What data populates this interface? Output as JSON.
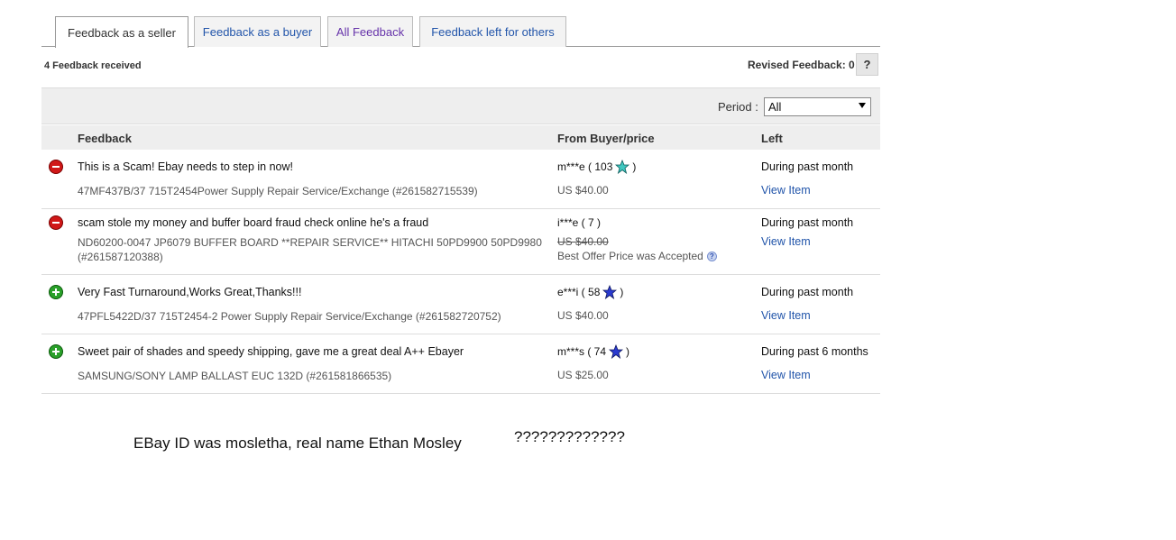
{
  "tabs": [
    {
      "label": "Feedback as a seller",
      "active": true
    },
    {
      "label": "Feedback as a buyer",
      "active": false
    },
    {
      "label": "All Feedback",
      "active": false
    },
    {
      "label": "Feedback left for others",
      "active": false
    }
  ],
  "summary": {
    "received": "4 Feedback received",
    "revised": "Revised Feedback: 0",
    "help": "?"
  },
  "period": {
    "label": "Period :",
    "selected": "All"
  },
  "columns": {
    "feedback": "Feedback",
    "from": "From Buyer/price",
    "left": "Left"
  },
  "rows": [
    {
      "rating": "negative",
      "comment": "This is a Scam! Ebay needs to step in now!",
      "item": "47MF437B/37 715T2454Power Supply Repair Service/Exchange (#261582715539)",
      "buyer": "m***e ( 103",
      "buyer_close": ")",
      "star_color": "#40c8c0",
      "price": "US $40.00",
      "left": "During past month",
      "view": "View Item"
    },
    {
      "rating": "negative",
      "comment": "scam stole my money and buffer board fraud check online he's a fraud",
      "item": "ND60200-0047 JP6079 BUFFER BOARD **REPAIR SERVICE** HITACHI 50PD9900 50PD9980 (#261587120388)",
      "buyer": "i***e ( 7 )",
      "price": "US $40.00",
      "best_offer": "Best Offer Price was Accepted",
      "left": "During past month",
      "view": "View Item"
    },
    {
      "rating": "positive",
      "comment": "Very Fast Turnaround,Works Great,Thanks!!!",
      "item": "47PFL5422D/37 715T2454-2 Power Supply Repair Service/Exchange (#261582720752)",
      "buyer": "e***i ( 58",
      "buyer_close": ")",
      "star_color": "#2a3ad0",
      "price": "US $40.00",
      "left": "During past month",
      "view": "View Item"
    },
    {
      "rating": "positive",
      "comment": "Sweet pair of shades and speedy shipping, gave me a great deal A++ Ebayer",
      "item": "SAMSUNG/SONY LAMP BALLAST EUC 132D (#261581866535)",
      "buyer": "m***s ( 74",
      "buyer_close": ")",
      "star_color": "#2a3ad0",
      "price": "US $25.00",
      "left": "During past 6 months",
      "view": "View Item"
    }
  ],
  "annotation": {
    "text": "EBay ID was mosletha, real name Ethan Mosley",
    "marks": "?????????????"
  }
}
